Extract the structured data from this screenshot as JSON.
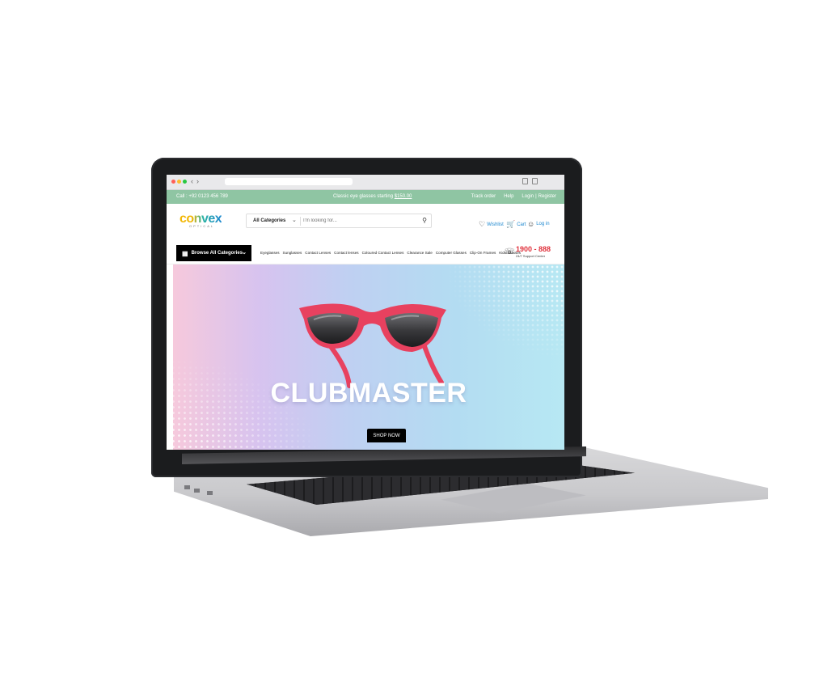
{
  "topbar": {
    "call": "Call : +92 0123 456 789",
    "promo_text": "Classic eye glasses starting",
    "promo_price": "$150.00",
    "links": [
      "Track order",
      "Help",
      "Login",
      "|",
      "Register"
    ]
  },
  "logo": {
    "brand": "CONVEX",
    "sub": "OPTICAL"
  },
  "search": {
    "category": "All Categories",
    "placeholder": "I'm looking for..."
  },
  "header": {
    "wishlist": "Wishlist",
    "cart": "Cart",
    "login": "Log in"
  },
  "nav": {
    "browse": "Browse All Categories",
    "items": [
      "Eyeglasses",
      "Sunglasses",
      "Contact Lenses",
      "Contact lenses",
      "Coloured Contact Lenses",
      "Clearance Sale",
      "Computer Glasses",
      "Clip-On Frames",
      "Kids Glasses"
    ]
  },
  "support": {
    "number": "1900 - 888",
    "label": "24/7 Support Center"
  },
  "hero": {
    "title": "CLUBMASTER",
    "cta": "SHOP NOW"
  },
  "colors": {
    "topbar": "#8fc5a3",
    "accent": "#1e88d0",
    "support": "#e0313c",
    "frame": "#e8415f"
  },
  "icons": [
    "search-icon",
    "heart-icon",
    "cart-icon",
    "user-icon",
    "grid-icon",
    "headset-icon",
    "chevron-down-icon"
  ]
}
